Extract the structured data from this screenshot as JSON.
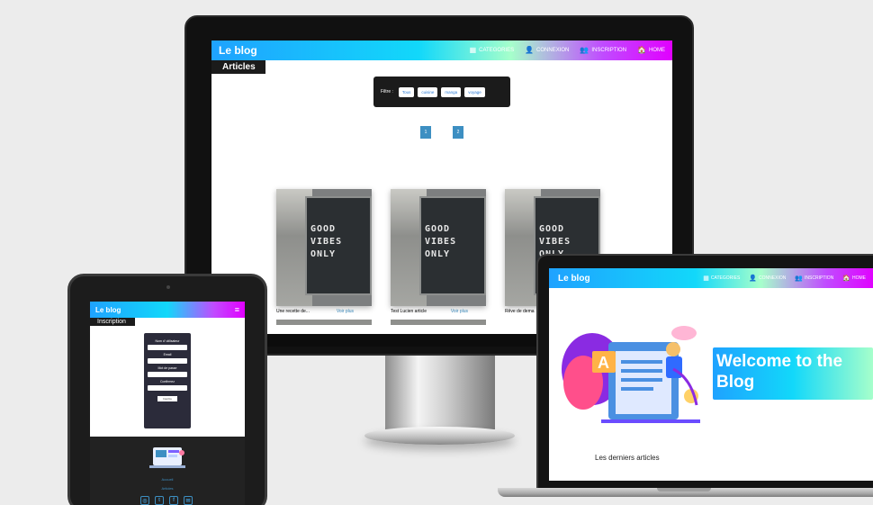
{
  "desktop": {
    "brand": "Le blog",
    "nav": [
      {
        "icon": "grid-icon",
        "glyph": "▦",
        "label": "CATEGORIES"
      },
      {
        "icon": "user-icon",
        "glyph": "👤",
        "label": "CONNEXION"
      },
      {
        "icon": "user-plus-icon",
        "glyph": "👥",
        "label": "INSCRIPTION"
      },
      {
        "icon": "home-icon",
        "glyph": "🏠",
        "label": "HOME"
      }
    ],
    "page_tag": "Articles",
    "filter": {
      "label": "Filtre :",
      "chips": [
        "Tous",
        "cuisine",
        "manga",
        "voyage"
      ]
    },
    "pages": [
      "1",
      "2"
    ],
    "cards": [
      {
        "image_text": [
          "GOOD",
          "VIBES",
          "ONLY"
        ],
        "title": "Une recette de...",
        "more": "Voir plus"
      },
      {
        "image_text": [
          "GOOD",
          "VIBES",
          "ONLY"
        ],
        "title": "Test Lucien article",
        "more": "Voir plus"
      },
      {
        "image_text": [
          "GOOD",
          "VIBES",
          "ONLY"
        ],
        "title": "Rêve de dema",
        "more": ""
      }
    ]
  },
  "tablet": {
    "brand": "Le blog",
    "menu_glyph": "≡",
    "page_tag": "Inscription",
    "form": {
      "fields": [
        "Nom d' utilisateur",
        "Email",
        "Mot de passe",
        "Confirmez"
      ],
      "submit": "Inscrire"
    },
    "footer": {
      "links": [
        "Accueil",
        "Articles"
      ],
      "socials": [
        "◎",
        "t",
        "f",
        "✉"
      ]
    }
  },
  "laptop": {
    "brand": "Le blog",
    "nav": [
      {
        "icon": "grid-icon",
        "glyph": "▦",
        "label": "CATEGORIES"
      },
      {
        "icon": "user-icon",
        "glyph": "👤",
        "label": "CONNEXION"
      },
      {
        "icon": "user-plus-icon",
        "glyph": "👥",
        "label": "INSCRIPTION"
      },
      {
        "icon": "home-icon",
        "glyph": "🏠",
        "label": "HOME"
      }
    ],
    "welcome": "Welcome to the Blog",
    "latest": "Les derniers articles"
  },
  "colors": {
    "gradient_start": "#1fa2ff",
    "gradient_mid": "#12d8fa",
    "gradient_end": "#e100ff",
    "link": "#3d8fc2",
    "dark_panel": "#1b1b1b"
  }
}
